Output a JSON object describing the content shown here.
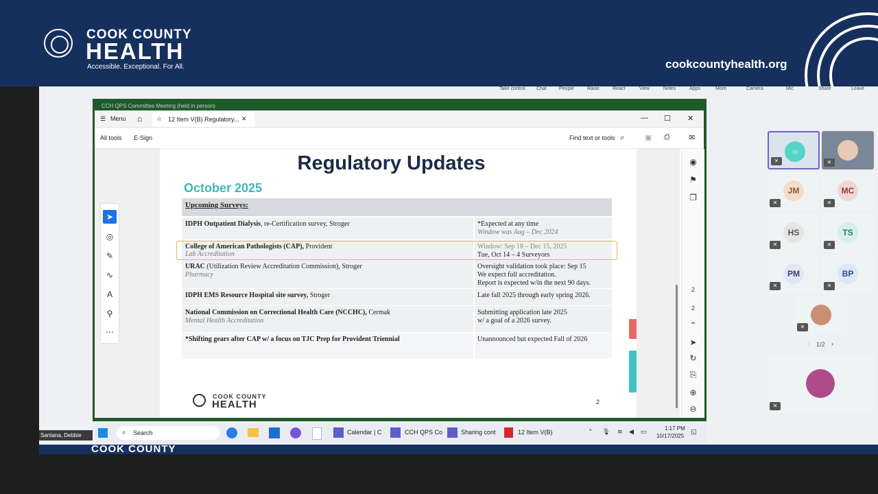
{
  "banner": {
    "org_line1": "COOK COUNTY",
    "org_line2": "HEALTH",
    "tagline": "Accessible. Exceptional. For All.",
    "website": "cookcountyhealth.org",
    "bg_color": "#16305e"
  },
  "teams_toolbar": {
    "items": [
      "Take control",
      "Chat",
      "People",
      "Raise",
      "React",
      "View",
      "Notes",
      "Apps",
      "More",
      "Camera",
      "Mic",
      "Share",
      "Leave"
    ]
  },
  "meeting_window": {
    "title": "CCH QPS Committee Meeting (held in person)"
  },
  "acrobat": {
    "menu_label": "Menu",
    "tab_label": "12 Item V(B) Regulatory...",
    "all_tools": "All tools",
    "esign": "E-Sign",
    "find": "Find text or tools",
    "page_current": "2",
    "page_total": "2"
  },
  "slide": {
    "title": "Regulatory Updates",
    "date": "October 2025",
    "section_header": "Upcoming Surveys:",
    "rows": [
      {
        "left_bold": "IDPH Outpatient Dialysis",
        "left_rest": ", re-Certification survey, Stroger",
        "left_sub": "",
        "right_main": "*Expected at any time",
        "right_sub": "Window was Aug – Dec 2024"
      },
      {
        "left_bold": "College of American Pathologists (CAP),",
        "left_rest": " Provident",
        "left_sub": "Lab Accreditation",
        "right_main": "Window: Sep 18 – Dec 15, 2025",
        "right_sub": "Tue, Oct 14 – 4 Surveyors"
      },
      {
        "left_bold": "URAC",
        "left_rest": " (Utilization Review Accreditation Commission), Stroger",
        "left_sub": "Pharmacy",
        "right_main": "Oversight validation took place: Sep 15",
        "right_sub": "We expect full accreditation.",
        "right_sub2": "Report is expected w/in the next 90 days."
      },
      {
        "left_bold": "IDPH EMS Resource Hospital site survey,",
        "left_rest": " Stroger",
        "left_sub": "",
        "right_main": "Late fall 2025 through early spring 2026.",
        "right_sub": ""
      },
      {
        "left_bold": "National Commission on Correctional Health Care (NCCHC),",
        "left_rest": " Cermak",
        "left_sub": "Mental Health Accreditation",
        "right_main": "Submitting application late 2025",
        "right_sub": "w/ a goal of a 2026 survey."
      },
      {
        "left_bold": "*Shifting gears after CAP w/ a focus on TJC Prep for Provident Triennial",
        "left_rest": "",
        "left_sub": "",
        "right_main": "Unannounced but expected Fall of 2026",
        "right_sub": ""
      }
    ],
    "footer_org1": "COOK COUNTY",
    "footer_org2": "HEALTH",
    "page_number": "2"
  },
  "taskbar": {
    "search": "Search",
    "calendar": "Calendar | C",
    "cch": "CCH QPS Co",
    "sharing": "Sharing cont",
    "item": "12 Item V(B)",
    "time": "1:17 PM",
    "date": "10/17/2025"
  },
  "speaker_name": "Santana, Debbie",
  "participants": {
    "initials": [
      "JM",
      "MC",
      "HS",
      "TS",
      "PM",
      "BP"
    ],
    "pager": "1/2"
  },
  "bottom_strip": {
    "text": "COOK COUNTY"
  }
}
